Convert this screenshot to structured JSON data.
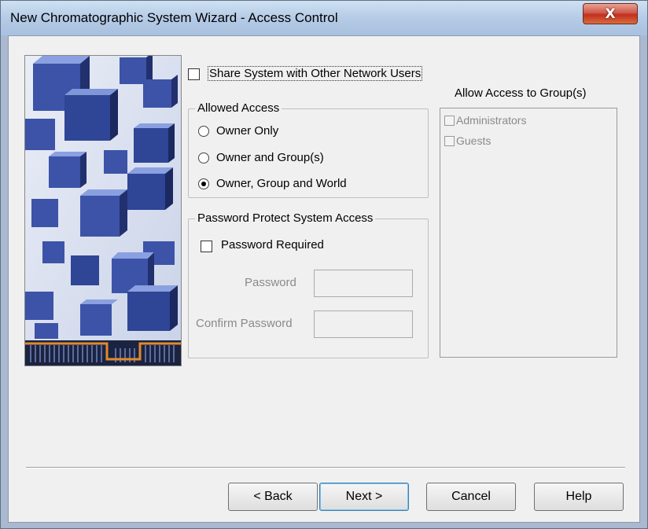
{
  "window": {
    "title": "New Chromatographic System Wizard - Access Control",
    "close_glyph": "X"
  },
  "share": {
    "label": "Share System with Other Network Users",
    "checked": false
  },
  "allowed_access": {
    "title": "Allowed Access",
    "options": [
      {
        "label": "Owner Only",
        "selected": false
      },
      {
        "label": "Owner and Group(s)",
        "selected": false
      },
      {
        "label": "Owner, Group and World",
        "selected": true
      }
    ]
  },
  "password": {
    "title": "Password Protect System Access",
    "required_label": "Password Required",
    "required_checked": false,
    "password_label": "Password",
    "confirm_label": "Confirm Password",
    "password_value": "",
    "confirm_value": ""
  },
  "groups": {
    "title": "Allow Access to Group(s)",
    "items": [
      {
        "label": "Administrators",
        "checked": false
      },
      {
        "label": "Guests",
        "checked": false
      }
    ]
  },
  "buttons": {
    "back": "< Back",
    "next": "Next >",
    "cancel": "Cancel",
    "help": "Help"
  },
  "colors": {
    "cube_dark": "#22306e",
    "cube_mid": "#3c53a8",
    "cube_light": "#8aa0e0",
    "accent_orange": "#e08a2c"
  }
}
